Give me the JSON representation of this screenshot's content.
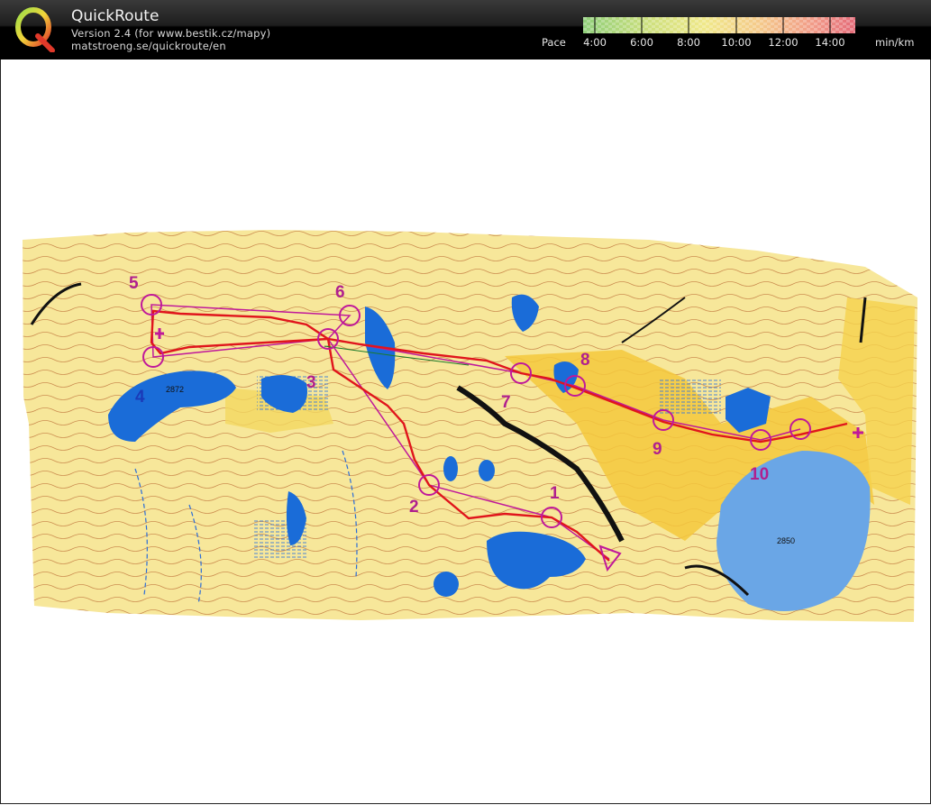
{
  "header": {
    "app_title": "QuickRoute",
    "version": "Version 2.4  (for www.bestik.cz/mapy)",
    "url": "matstroeng.se/quickroute/en",
    "pace_label": "Pace",
    "pace_unit": "min/km",
    "pace_ticks": [
      "4:00",
      "6:00",
      "8:00",
      "10:00",
      "12:00",
      "14:00"
    ],
    "pace_colors": [
      "#6dbf5a",
      "#c8dc6a",
      "#f0e86c",
      "#f5c86c",
      "#f08a6a",
      "#e84c5a"
    ]
  },
  "map": {
    "control_numbers": [
      "1",
      "2",
      "3",
      "4",
      "5",
      "6",
      "7",
      "8",
      "9",
      "10"
    ],
    "lake_labels": [
      "2872",
      "2850"
    ],
    "course_color": "#c0189a",
    "route_color": "#e0151c"
  }
}
